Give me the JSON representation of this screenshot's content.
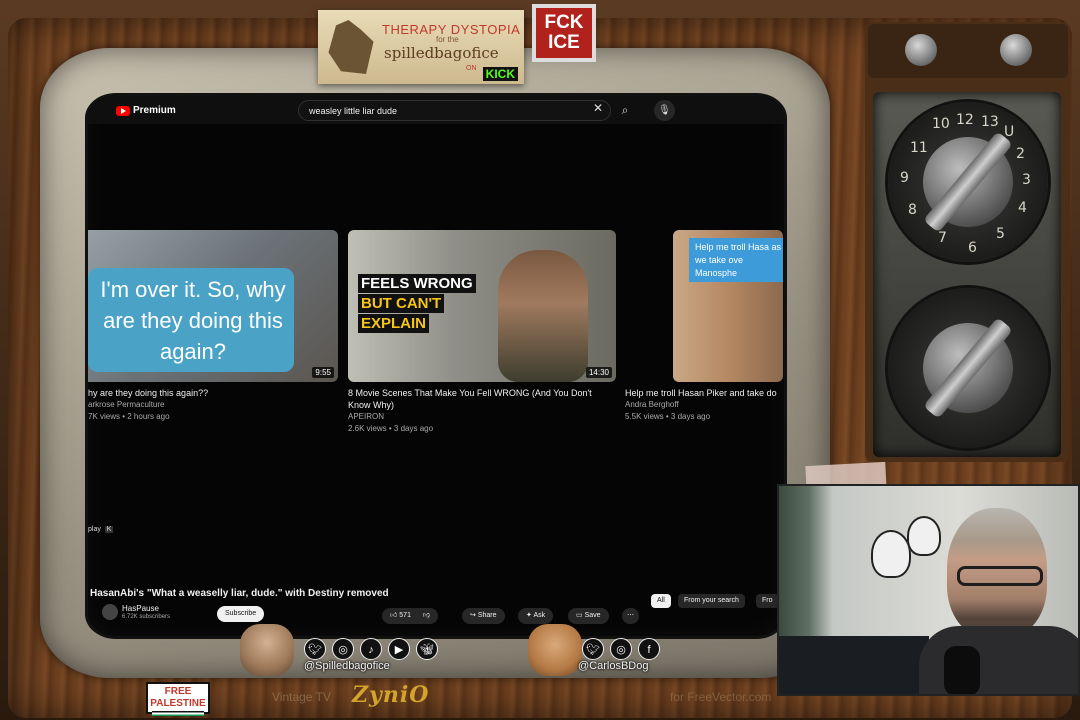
{
  "overlay": {
    "sticker_left": {
      "line1": "THERAPY DYSTOPIA",
      "line2": "spilledbagofice",
      "small": "for the",
      "on": "ON",
      "platform": "KICK"
    },
    "sticker_right": "FCK ICE",
    "bottom_brand": "ZyniO",
    "bottom_left_text": "Vintage TV",
    "bottom_right_text": "for FreeVector.com",
    "palestine_badge": "FREE PALESTINE",
    "social_left": {
      "handle": "@Spilledbagofice",
      "icons": [
        "twitter-icon",
        "instagram-icon",
        "tiktok-icon",
        "youtube-icon",
        "bluesky-icon"
      ]
    },
    "social_right": {
      "handle": "@CarlosBDog",
      "icons": [
        "twitter-icon",
        "instagram-icon",
        "facebook-icon"
      ]
    }
  },
  "dial": {
    "numbers": [
      "12",
      "13",
      "U",
      "2",
      "3",
      "4",
      "5",
      "6",
      "7",
      "8",
      "9",
      "10",
      "11"
    ]
  },
  "youtube": {
    "logo_text": "Premium",
    "search_value": "weasley little liar dude",
    "videos": [
      {
        "title": "hy are they doing this again??",
        "channel": "arkrose Permaculture",
        "meta": "7K views • 2 hours ago",
        "duration": "9:55",
        "thumb_text": "I'm over it. So, why are they doing this again?"
      },
      {
        "title": "8 Movie Scenes That Make You Fell WRONG (And You Don't Know Why)",
        "channel": "APEIRON",
        "meta": "2.6K views • 3 days ago",
        "duration": "14:30",
        "thumb_line1": "FEELS WRONG",
        "thumb_line2": "BUT CAN'T",
        "thumb_line3": "EXPLAIN"
      },
      {
        "title": "Help me troll Hasan Piker and take do",
        "channel": "Andra Berghoff",
        "meta": "5.5K views • 3 days ago",
        "thumb_text": "Help me troll Hasa as we take ove Manosphe"
      }
    ],
    "autoplay_label": "play",
    "autoplay_key": "K",
    "video_title": "HasanAbi's \"What a weaselly liar, dude.\" with Destiny removed",
    "channel_name": "HasPause",
    "subscribers": "6.72K subscribers",
    "subscribe_label": "Subscribe",
    "likes": "571",
    "share_label": "Share",
    "ask_label": "Ask",
    "save_label": "Save",
    "chips": [
      "All",
      "From your search",
      "Fro"
    ]
  },
  "colors": {
    "yt_red": "#ff0000",
    "kick_green": "#53fc18",
    "thumb_blue": "#4aa3c7",
    "ice_red": "#b0221b"
  }
}
